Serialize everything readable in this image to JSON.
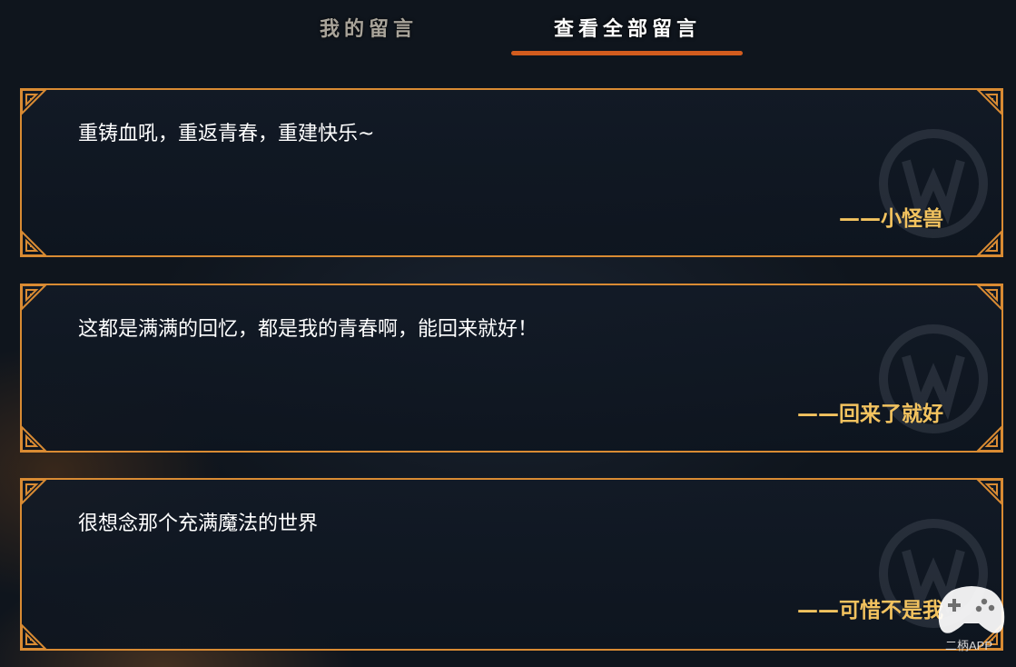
{
  "tabs": {
    "mine_label": "我的留言",
    "all_label": "查看全部留言",
    "active": "all"
  },
  "messages": [
    {
      "text": "重铸血吼，重返青春，重建快乐~",
      "author": "——小怪兽"
    },
    {
      "text": "这都是满满的回忆，都是我的青春啊，能回来就好！",
      "author": "——回来了就好"
    },
    {
      "text": "很想念那个充满魔法的世界",
      "author": "——可惜不是我"
    }
  ],
  "colors": {
    "accent": "#d25c1e",
    "border": "#d98b33",
    "author": "#f3c35f"
  },
  "icons": {
    "corner": "ornament-corner-icon",
    "watermark": "warcraft-emblem-icon",
    "app_logo": "gamepad-icon"
  },
  "app_badge": {
    "label": "二柄APP"
  }
}
